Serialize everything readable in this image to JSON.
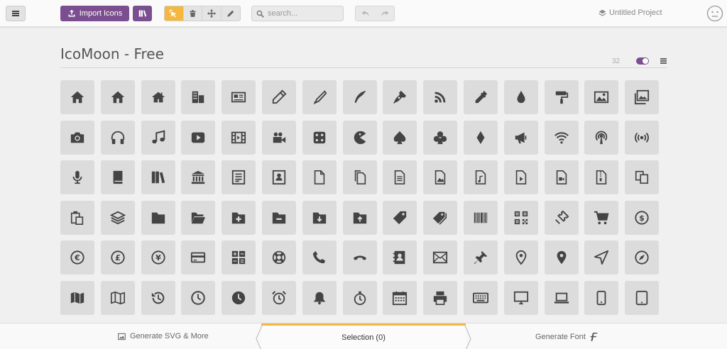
{
  "topbar": {
    "import_label": "Import Icons",
    "search_placeholder": "search...",
    "project_name": "Untitled Project"
  },
  "set": {
    "title": "IcoMoon - Free",
    "count": "32"
  },
  "icons": [
    "home-icon",
    "home2-icon",
    "home3-icon",
    "office-icon",
    "newspaper-icon",
    "pencil-icon",
    "pencil2-icon",
    "quill-icon",
    "pen-icon",
    "blog-icon",
    "eyedropper-icon",
    "droplet-icon",
    "paint-format-icon",
    "image-icon",
    "images-icon",
    "camera-icon",
    "headphones-icon",
    "music-icon",
    "play-icon",
    "film-icon",
    "video-camera-icon",
    "dice-icon",
    "pacman-icon",
    "spades-icon",
    "clubs-icon",
    "diamonds-icon",
    "bullhorn-icon",
    "connection-icon",
    "podcast-icon",
    "feed-icon",
    "mic-icon",
    "book-icon",
    "books-icon",
    "library-icon",
    "file-text-icon",
    "profile-icon",
    "file-empty-icon",
    "files-empty-icon",
    "file-text2-icon",
    "file-picture-icon",
    "file-music-icon",
    "file-play-icon",
    "file-video-icon",
    "file-zip-icon",
    "copy-icon",
    "paste-icon",
    "stack-icon",
    "folder-icon",
    "folder-open-icon",
    "folder-plus-icon",
    "folder-minus-icon",
    "folder-download-icon",
    "folder-upload-icon",
    "price-tag-icon",
    "price-tags-icon",
    "barcode-icon",
    "qrcode-icon",
    "ticket-icon",
    "cart-icon",
    "coin-dollar-icon",
    "coin-euro-icon",
    "coin-pound-icon",
    "coin-yen-icon",
    "credit-card-icon",
    "calculator-icon",
    "lifebuoy-icon",
    "phone-icon",
    "phone-hang-up-icon",
    "address-book-icon",
    "envelop-icon",
    "pushpin-icon",
    "location-icon",
    "location2-icon",
    "compass-icon",
    "compass2-icon",
    "map-icon",
    "map2-icon",
    "history-icon",
    "clock-icon",
    "clock2-icon",
    "alarm-icon",
    "bell-icon",
    "stopwatch-icon",
    "calendar-icon",
    "printer-icon",
    "keyboard-icon",
    "display-icon",
    "laptop-icon",
    "mobile-icon",
    "tablet-icon"
  ],
  "bottombar": {
    "generate_svg_label": "Generate SVG & More",
    "selection_label": "Selection (0)",
    "generate_font_label": "Generate Font"
  },
  "colors": {
    "accent": "#7b4f8f",
    "tool_active": "#f4b73f",
    "icon": "#444444",
    "tile": "#dcdcdc"
  }
}
